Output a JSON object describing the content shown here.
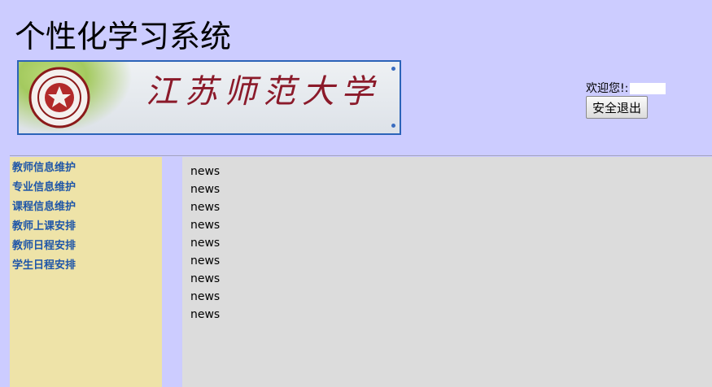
{
  "header": {
    "title": "个性化学习系统",
    "banner": {
      "logotype": "江苏师范大学"
    },
    "welcome_text": "欢迎您!:",
    "logout_label": "安全退出"
  },
  "sidebar": {
    "items": [
      {
        "label": "教师信息维护"
      },
      {
        "label": "专业信息维护"
      },
      {
        "label": "课程信息维护"
      },
      {
        "label": "教师上课安排"
      },
      {
        "label": "教师日程安排"
      },
      {
        "label": "学生日程安排"
      }
    ]
  },
  "content": {
    "news": [
      "news",
      "news",
      "news",
      "news",
      "news",
      "news",
      "news",
      "news",
      "news"
    ]
  },
  "colors": {
    "page_bg": "#ccccff",
    "sidebar_bg": "#eee3a8",
    "content_bg": "#dcdcdc",
    "link": "#1f56a8"
  }
}
